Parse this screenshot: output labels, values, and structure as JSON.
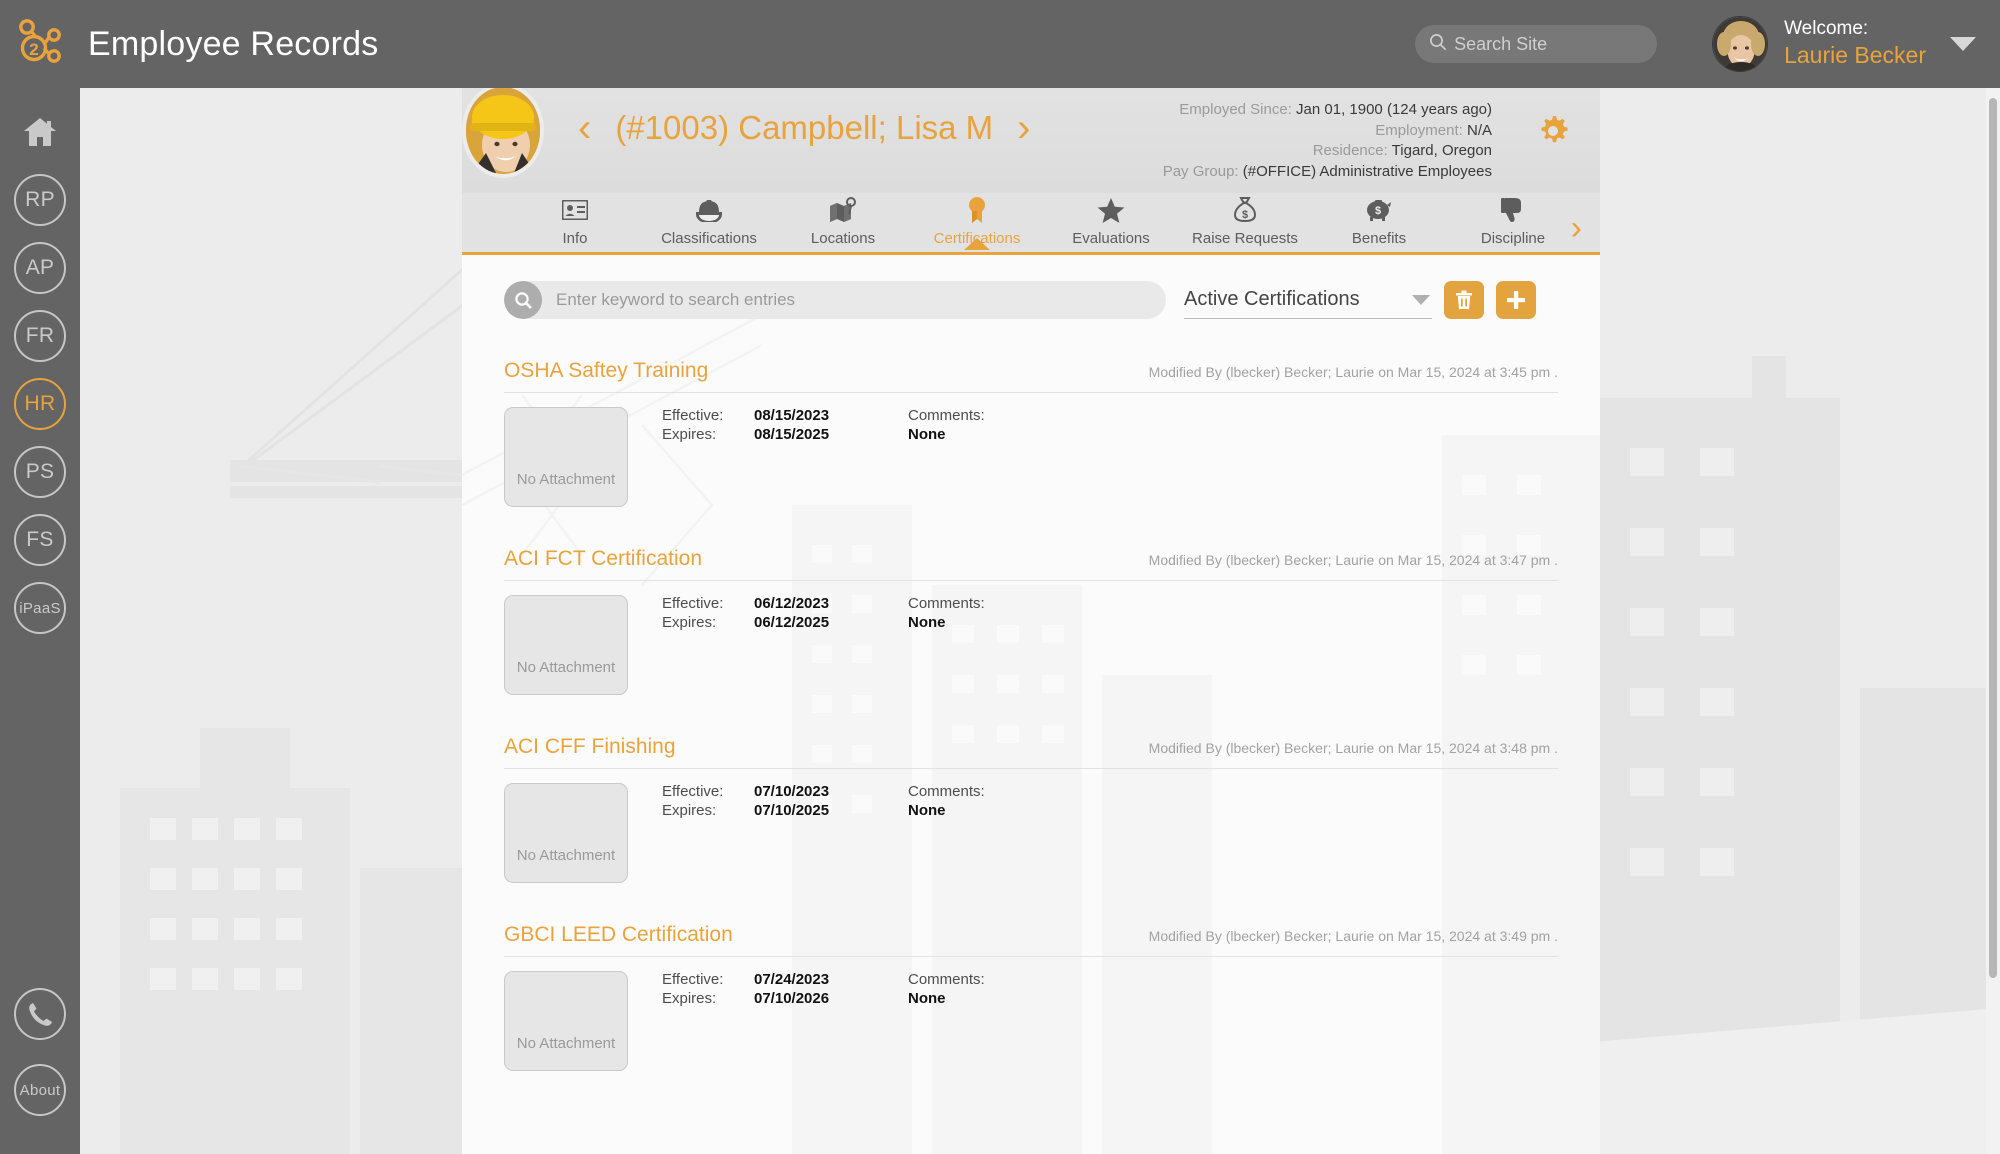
{
  "app": {
    "title": "Employee Records",
    "logo_icon": "two-nodes-logo-icon"
  },
  "topbar": {
    "search": {
      "placeholder": "Search Site",
      "value": "",
      "icon": "search-icon"
    },
    "welcome_label": "Welcome:",
    "user_name": "Laurie Becker",
    "caret_icon": "chevron-down-icon",
    "avatar_icon": "user-avatar"
  },
  "sidebar": {
    "items": [
      {
        "label": "",
        "icon": "home-icon",
        "type": "icon",
        "active": false
      },
      {
        "label": "RP",
        "icon": "rp-icon",
        "type": "circle",
        "active": false
      },
      {
        "label": "AP",
        "icon": "ap-icon",
        "type": "circle",
        "active": false
      },
      {
        "label": "FR",
        "icon": "fr-icon",
        "type": "circle",
        "active": false
      },
      {
        "label": "HR",
        "icon": "hr-icon",
        "type": "circle",
        "active": true
      },
      {
        "label": "PS",
        "icon": "ps-icon",
        "type": "circle",
        "active": false
      },
      {
        "label": "FS",
        "icon": "fs-icon",
        "type": "circle",
        "active": false
      },
      {
        "label": "iPaaS",
        "icon": "ipaas-icon",
        "type": "circle",
        "active": false
      }
    ],
    "bottom_items": [
      {
        "label": "",
        "icon": "phone-icon",
        "type": "circle"
      },
      {
        "label": "About",
        "icon": "about-icon",
        "type": "circle"
      }
    ]
  },
  "employee": {
    "prev_icon": "chevron-left-icon",
    "next_icon": "chevron-right-icon",
    "name": "(#1003) Campbell; Lisa M",
    "photo_icon": "employee-photo",
    "settings_icon": "gear-icon",
    "meta": [
      {
        "key": "Employed Since:",
        "value": "Jan 01, 1900 (124 years ago)"
      },
      {
        "key": "Employment:",
        "value": "N/A"
      },
      {
        "key": "Residence:",
        "value": "Tigard, Oregon"
      },
      {
        "key": "Pay Group:",
        "value": "(#OFFICE) Administrative Employees"
      }
    ]
  },
  "tabs": {
    "items": [
      {
        "label": "Info",
        "icon": "id-card-icon",
        "active": false
      },
      {
        "label": "Classifications",
        "icon": "hard-hat-icon",
        "active": false
      },
      {
        "label": "Locations",
        "icon": "map-pin-icon",
        "active": false
      },
      {
        "label": "Certifications",
        "icon": "award-ribbon-icon",
        "active": true
      },
      {
        "label": "Evaluations",
        "icon": "star-icon",
        "active": false
      },
      {
        "label": "Raise Requests",
        "icon": "money-bag-icon",
        "active": false
      },
      {
        "label": "Benefits",
        "icon": "piggy-bank-icon",
        "active": false
      },
      {
        "label": "Discipline",
        "icon": "thumbs-down-icon",
        "active": false
      }
    ],
    "next_icon": "chevron-right-icon"
  },
  "toolbar": {
    "search": {
      "placeholder": "Enter keyword to search entries",
      "value": "",
      "icon": "search-icon"
    },
    "filter": {
      "value": "Active Certifications",
      "caret_icon": "chevron-down-icon"
    },
    "delete_icon": "trash-icon",
    "add_icon": "plus-icon"
  },
  "labels": {
    "effective": "Effective:",
    "expires": "Expires:",
    "comments": "Comments:",
    "no_attachment": "No Attachment"
  },
  "certifications": [
    {
      "title": "OSHA Saftey Training",
      "modified": "Modified By (lbecker) Becker; Laurie on Mar 15, 2024 at 3:45 pm .",
      "effective": "08/15/2023",
      "expires": "08/15/2025",
      "comments": "None",
      "attachment": "No Attachment"
    },
    {
      "title": "ACI FCT Certification",
      "modified": "Modified By (lbecker) Becker; Laurie on Mar 15, 2024 at 3:47 pm .",
      "effective": "06/12/2023",
      "expires": "06/12/2025",
      "comments": "None",
      "attachment": "No Attachment"
    },
    {
      "title": "ACI CFF Finishing",
      "modified": "Modified By (lbecker) Becker; Laurie on Mar 15, 2024 at 3:48 pm .",
      "effective": "07/10/2023",
      "expires": "07/10/2025",
      "comments": "None",
      "attachment": "No Attachment"
    },
    {
      "title": "GBCI LEED Certification",
      "modified": "Modified By (lbecker) Becker; Laurie on Mar 15, 2024 at 3:49 pm .",
      "effective": "07/24/2023",
      "expires": "07/10/2026",
      "comments": "None",
      "attachment": "No Attachment"
    }
  ],
  "colors": {
    "accent": "#e8a33d",
    "chrome": "#646464",
    "panel_bg": "#fbfbfb",
    "page_bg": "#ececec"
  }
}
